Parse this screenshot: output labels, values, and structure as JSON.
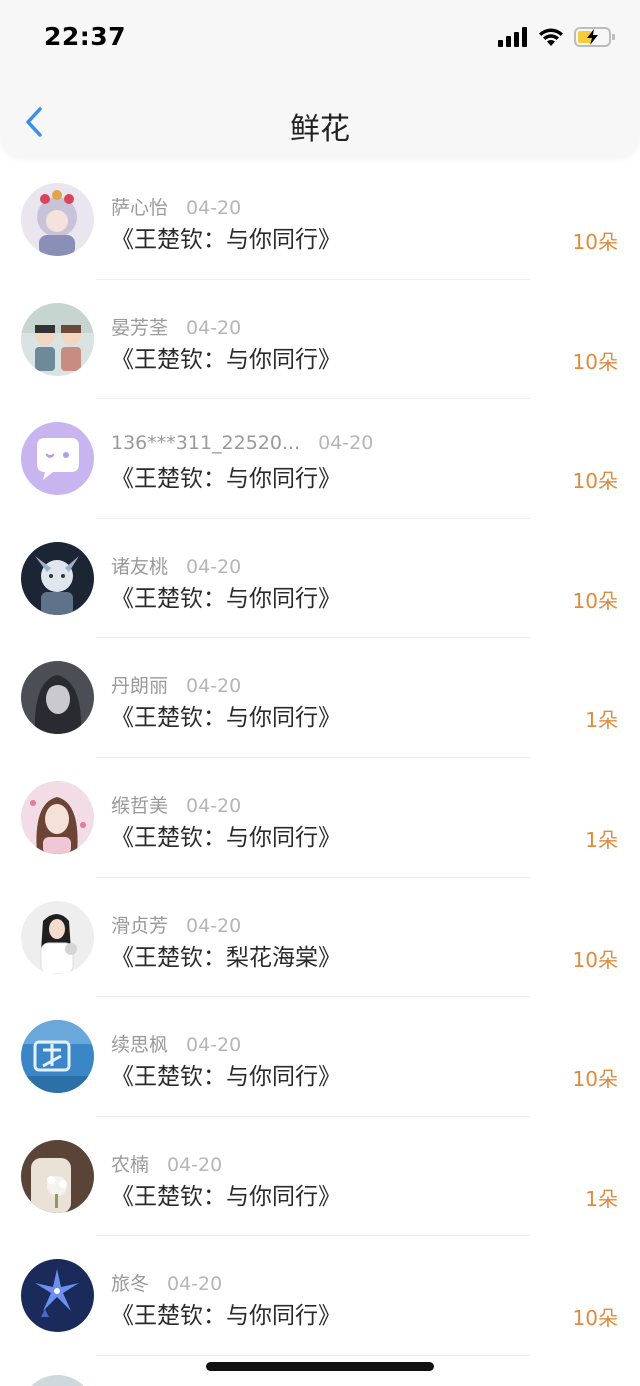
{
  "status_bar": {
    "time": "22:37",
    "signal_icon": "cellular-signal-icon",
    "wifi_icon": "wifi-icon",
    "battery_icon": "battery-charging-icon"
  },
  "header": {
    "title": "鲜花",
    "back_icon": "chevron-left-icon"
  },
  "colors": {
    "amount": "#e08a3c",
    "back": "#3a8fe8",
    "name": "#9a9a9a",
    "book": "#2a2a2a"
  },
  "items": [
    {
      "name": "萨心怡",
      "date": "04-20",
      "book": "《王楚钦：与你同行》",
      "amount": "10朵"
    },
    {
      "name": "晏芳荃",
      "date": "04-20",
      "book": "《王楚钦：与你同行》",
      "amount": "10朵"
    },
    {
      "name": "136***311_22520...",
      "date": "04-20",
      "book": "《王楚钦：与你同行》",
      "amount": "10朵"
    },
    {
      "name": "诸友桃",
      "date": "04-20",
      "book": "《王楚钦：与你同行》",
      "amount": "10朵"
    },
    {
      "name": "丹朗丽",
      "date": "04-20",
      "book": "《王楚钦：与你同行》",
      "amount": "1朵"
    },
    {
      "name": "缑哲美",
      "date": "04-20",
      "book": "《王楚钦：与你同行》",
      "amount": "1朵"
    },
    {
      "name": "滑贞芳",
      "date": "04-20",
      "book": "《王楚钦：梨花海棠》",
      "amount": "10朵"
    },
    {
      "name": "续思枫",
      "date": "04-20",
      "book": "《王楚钦：与你同行》",
      "amount": "10朵"
    },
    {
      "name": "农楠",
      "date": "04-20",
      "book": "《王楚钦：与你同行》",
      "amount": "1朵"
    },
    {
      "name": "旅冬",
      "date": "04-20",
      "book": "《王楚钦：与你同行》",
      "amount": "10朵"
    }
  ]
}
